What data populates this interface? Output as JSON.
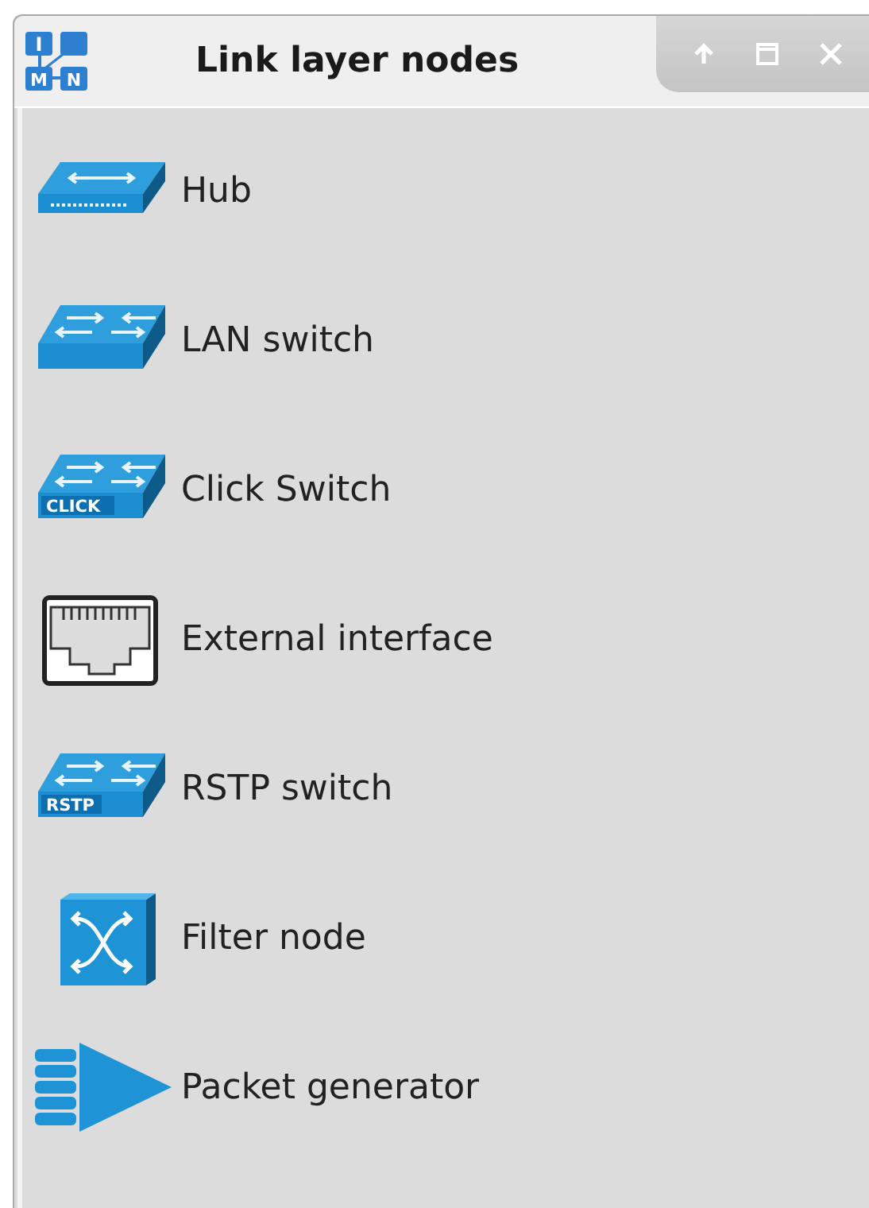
{
  "window": {
    "title": "Link layer nodes",
    "logo_letters": [
      "I",
      "M",
      "N"
    ],
    "buttons": [
      {
        "kind": "up"
      },
      {
        "kind": "maximize"
      },
      {
        "kind": "close"
      }
    ]
  },
  "nodes": [
    {
      "kind": "hub",
      "label": "Hub"
    },
    {
      "kind": "switch",
      "label": "LAN switch"
    },
    {
      "kind": "switch",
      "label": "Click Switch",
      "badge": "CLICK"
    },
    {
      "kind": "port",
      "label": "External interface"
    },
    {
      "kind": "switch",
      "label": "RSTP switch",
      "badge": "RSTP"
    },
    {
      "kind": "filter",
      "label": "Filter node"
    },
    {
      "kind": "generator",
      "label": "Packet generator"
    }
  ]
}
